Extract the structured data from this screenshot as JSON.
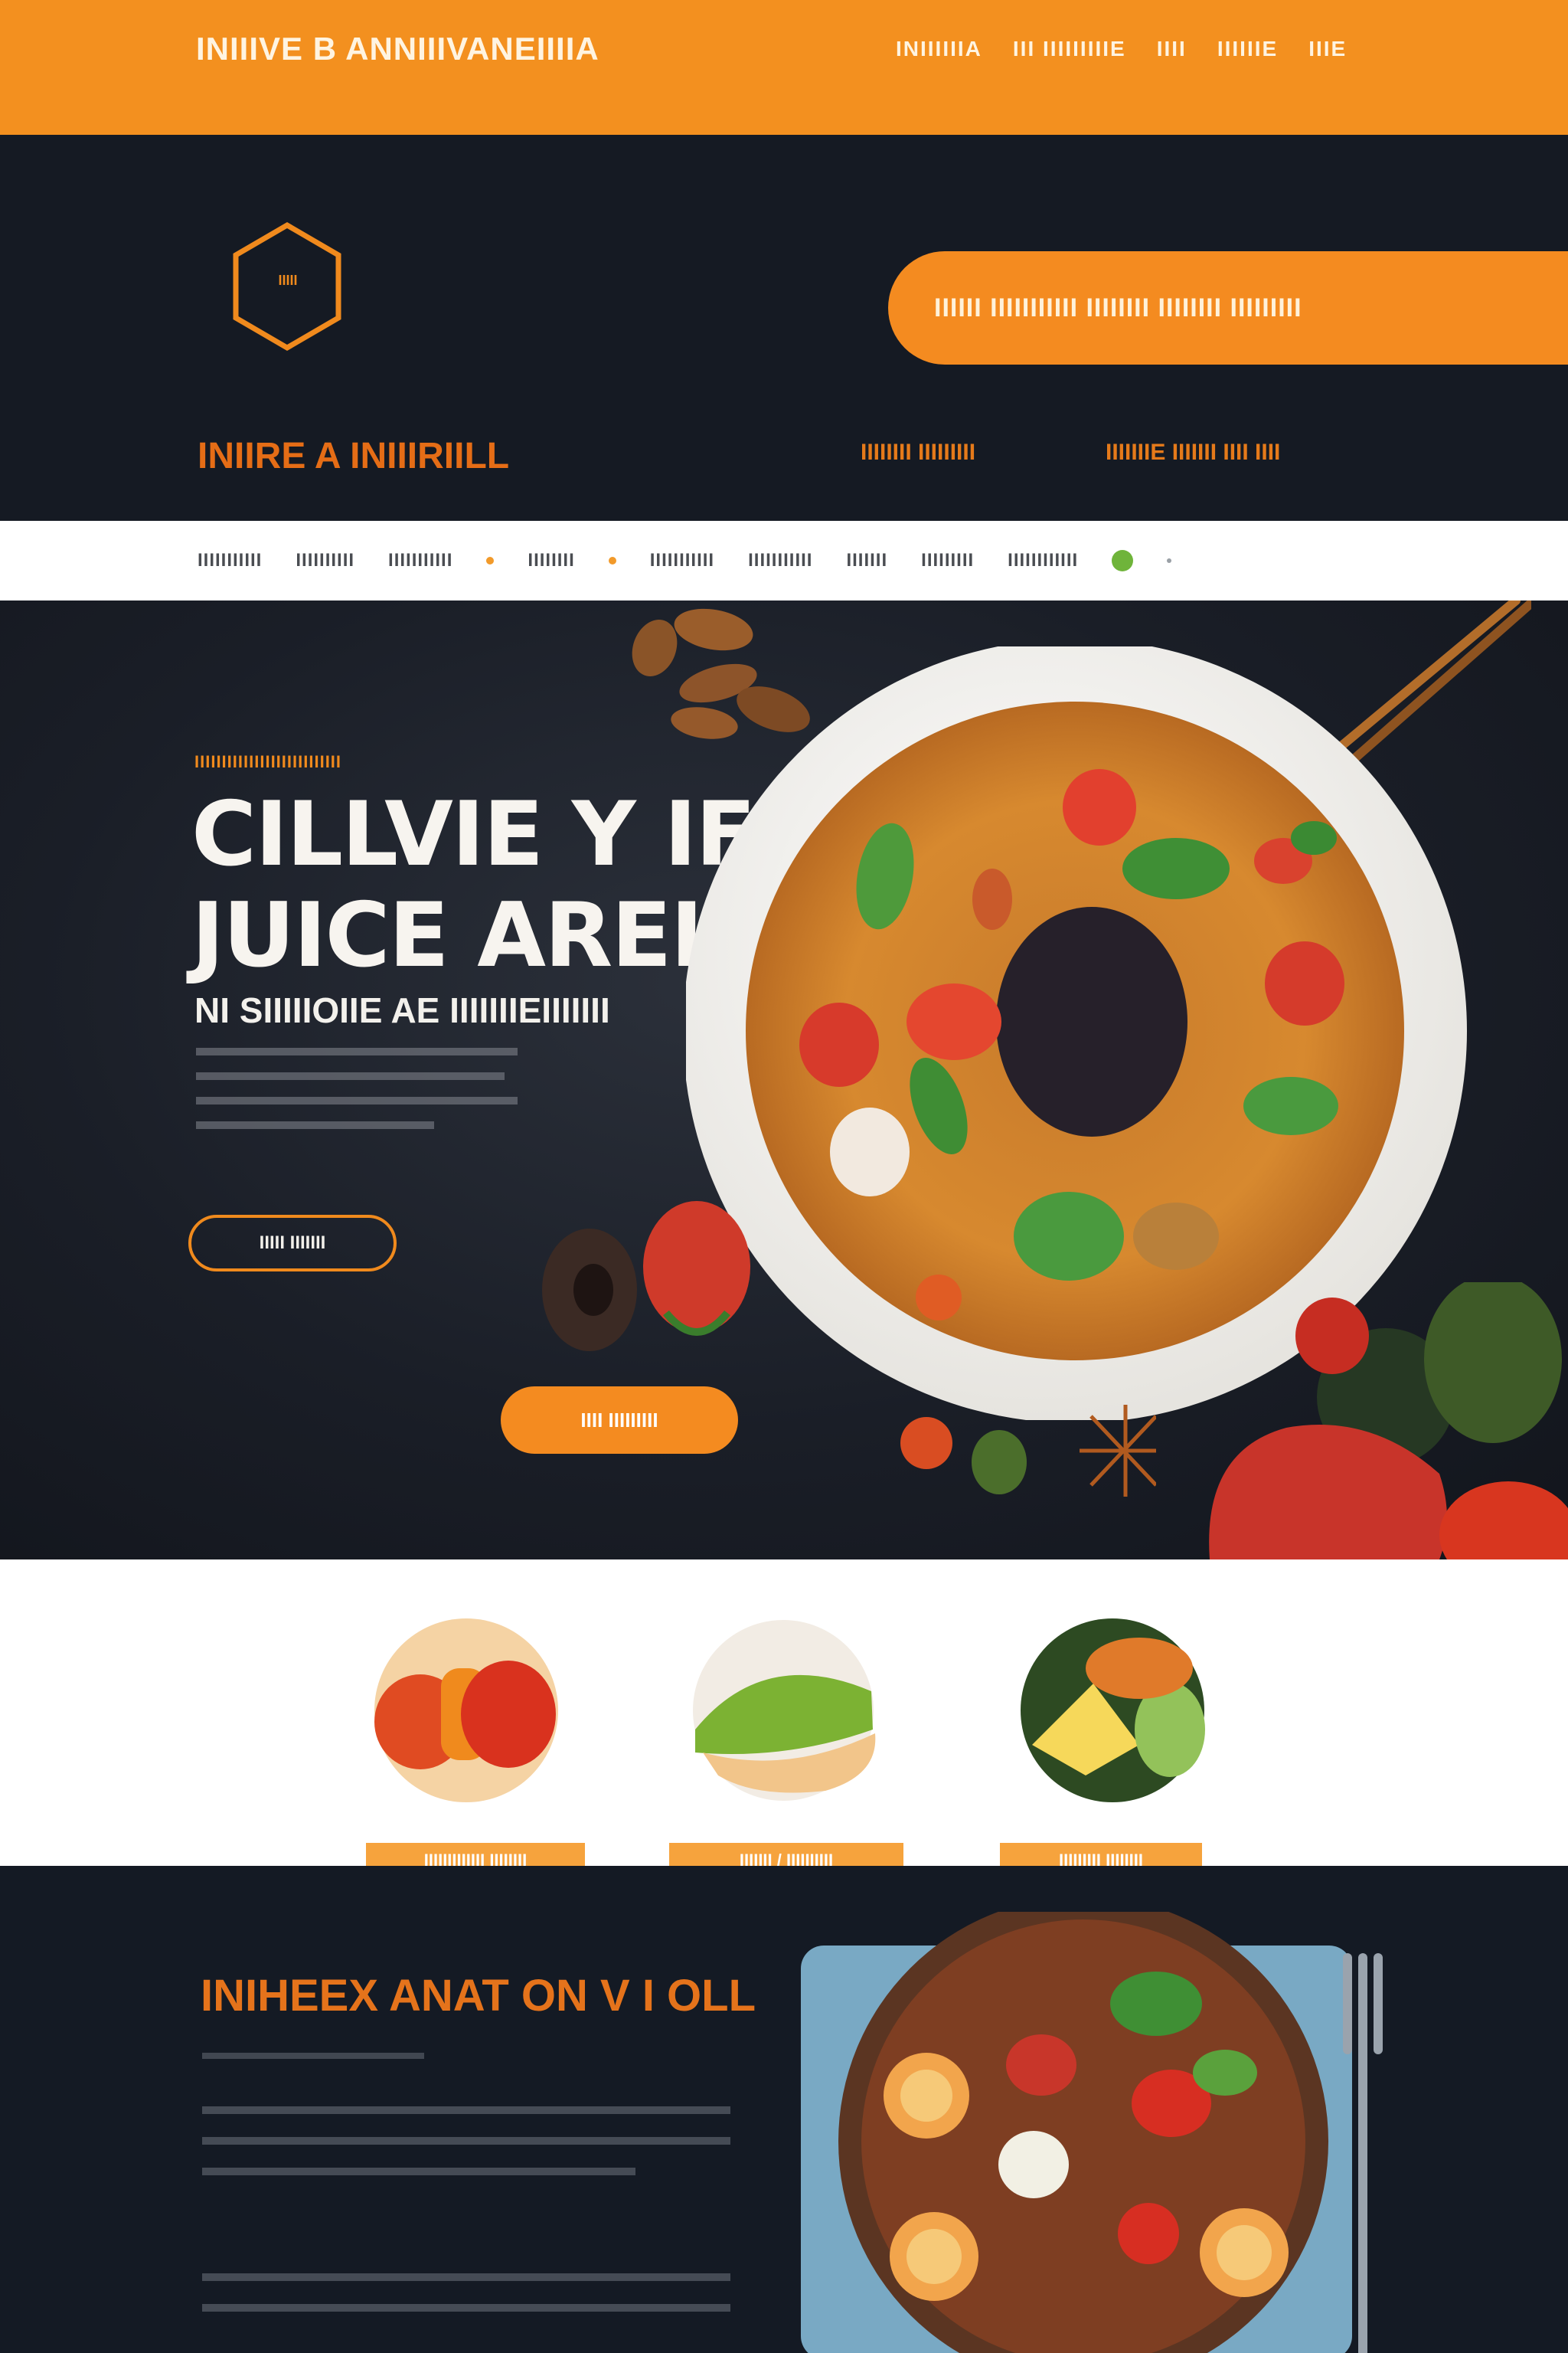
{
  "topbar": {
    "brand": "INIIIVE B ANNIIIVANEIIIIA",
    "nav": [
      "INIIIIIIA",
      "III IIIIIIIIIE",
      "IIII",
      "IIIIIIE",
      "IIIE"
    ]
  },
  "header": {
    "logo_text": "IIIII",
    "cta": "IIIIII IIIIIIIIIII IIIIIIII IIIIIIII IIIIIIIII",
    "tagline": "INIIRE A INIIIRIILL",
    "link1": "IIIIIIII IIIIIIIII",
    "link2": "IIIIIIIE IIIIIII IIII IIII"
  },
  "subnav": {
    "items": [
      "IIIIIIIIIII",
      "IIIIIIIIII",
      "IIIIIIIIIII",
      "IIIIIIII",
      "IIIIIIIIIII",
      "IIIIIIIIIII",
      "IIIIIII",
      "IIIIIIIII",
      "IIIIIIIIIIII"
    ]
  },
  "hero": {
    "eyebrow": "IIIIIIIIIIIIIIIIIIIIIIIIIII",
    "title": "CILLVIE Y IFOR\nJUICE AREL IIL",
    "subtitle": "NI SIIIIIOIIE AE IIIIIIIEIIIIIII",
    "button_outline": "IIIII  IIIIIII",
    "button_filled": "IIII IIIIIIIII"
  },
  "categories": [
    {
      "label": "IIIIIIIIIIIII  IIIIIIII"
    },
    {
      "label": "IIIIIII /  IIIIIIIIII"
    },
    {
      "label": "IIIIIIIII  IIIIIIII"
    }
  ],
  "bottom": {
    "title": "INIHEEX ANAT ON V I OLL"
  },
  "colors": {
    "orange": "#f3901f",
    "dark": "#151a23",
    "white": "#ffffff"
  }
}
